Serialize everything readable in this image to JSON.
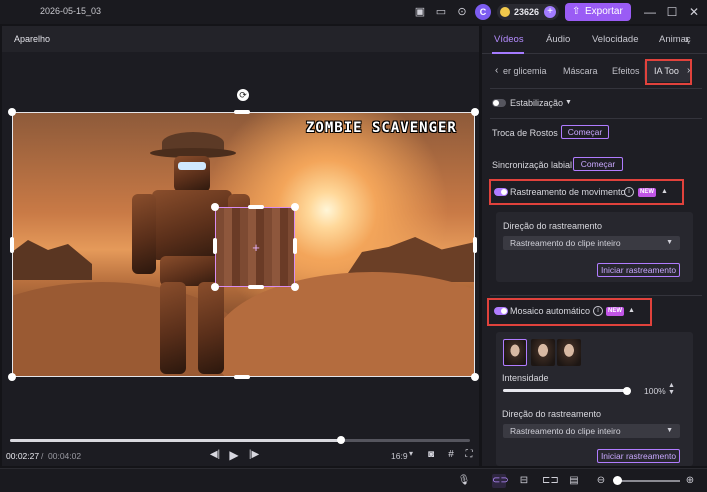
{
  "titlebar": {
    "project_name": "2026-05-15_03",
    "avatar_letter": "C",
    "credits": "23626",
    "export_label": "Exportar",
    "icons": [
      "layout-icon",
      "feedback-icon",
      "download-icon",
      "credits-icon",
      "export-icon",
      "minimize-icon",
      "maximize-icon",
      "close-icon"
    ]
  },
  "player": {
    "title": "Aparelho",
    "video_title_text": "ZOMBIE SCAVENGER",
    "current_time": "00:02:27",
    "separator": "/",
    "total_time": "00:04:02",
    "progress": 0.72,
    "aspect_ratio": "16:9"
  },
  "right_panel": {
    "tabs": [
      {
        "label": "Vídeos",
        "active": true
      },
      {
        "label": "Áudio",
        "active": false
      },
      {
        "label": "Velocidade",
        "active": false
      },
      {
        "label": "Animaç",
        "active": false
      }
    ],
    "subtabs": [
      {
        "label": "er glicemia",
        "active": false
      },
      {
        "label": "Máscara",
        "active": false
      },
      {
        "label": "Efeitos",
        "active": false
      },
      {
        "label": "IA Too",
        "active": true
      }
    ],
    "stabilization": {
      "label": "Estabilização",
      "enabled": false
    },
    "face_swap": {
      "label": "Troca de Rostos",
      "button": "Começar"
    },
    "lip_sync": {
      "label": "Sincronização labial",
      "button": "Começar"
    },
    "motion_tracking": {
      "label": "Rastreamento de movimento",
      "enabled": true,
      "badge": "NEW",
      "direction_label": "Direção do rastreamento",
      "direction_value": "Rastreamento do clipe inteiro",
      "start_button": "Iniciar rastreamento"
    },
    "auto_mosaic": {
      "label": "Mosaico automático",
      "enabled": true,
      "badge": "NEW",
      "intensity_label": "Intensidade",
      "intensity_value": "100%",
      "intensity": 1.0,
      "direction_label": "Direção do rastreamento",
      "direction_value": "Rastreamento do clipe inteiro",
      "start_button": "Iniciar rastreamento"
    }
  },
  "colors": {
    "accent": "#a57bff",
    "export_button": "#9a5cf5",
    "highlight_box": "#e1423c",
    "new_badge": "#c155e6"
  }
}
